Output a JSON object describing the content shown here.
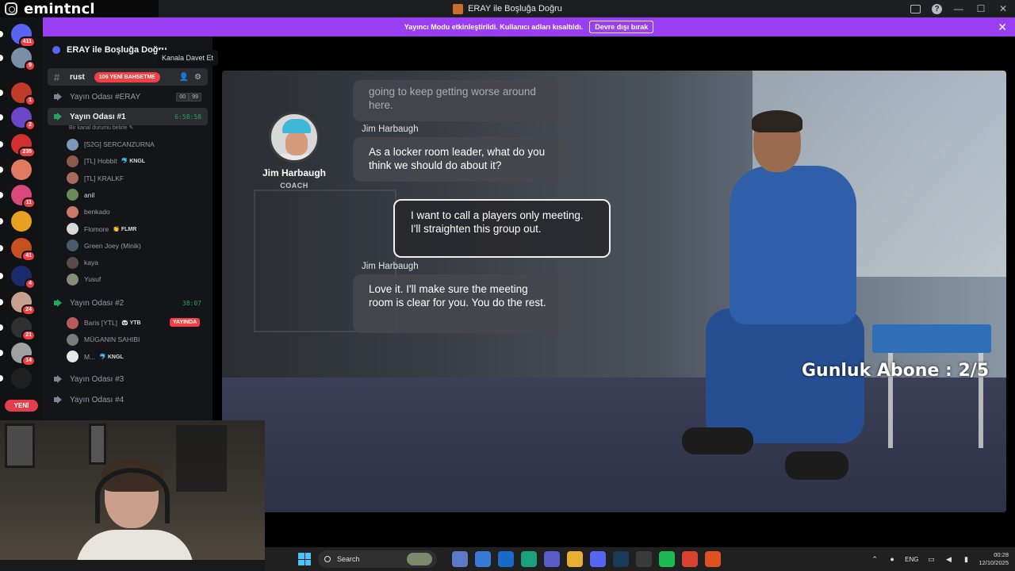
{
  "overlay": {
    "streamer_handle": "emintncl",
    "sub_counter": "Gunluk Abone : 2/5"
  },
  "window": {
    "title": "ERAY ile Boşluğa Doğru"
  },
  "banner": {
    "text": "Yayıncı Modu etkinleştirildi. Kullanıcı adları kısaltıldı.",
    "button": "Devre dışı bırak",
    "color": "#9a3ef2"
  },
  "rail": {
    "servers": [
      {
        "badge": "411",
        "color": "#5865f2"
      },
      {
        "badge": "9",
        "color": "#7a8ea8"
      },
      {
        "badge": "1",
        "color": "#c23b2a"
      },
      {
        "badge": "2",
        "color": "#6b46c8"
      },
      {
        "badge": "235",
        "color": "#d23030"
      },
      {
        "badge": "",
        "color": "#e07a60"
      },
      {
        "badge": "11",
        "color": "#d84878"
      },
      {
        "badge": "",
        "color": "#e8a020"
      },
      {
        "badge": "41",
        "color": "#c85020"
      },
      {
        "badge": "4",
        "color": "#1a2a6a"
      },
      {
        "badge": "24",
        "color": "#c8a090"
      },
      {
        "badge": "21",
        "color": "#303030"
      },
      {
        "badge": "14",
        "color": "#a0a0a0"
      },
      {
        "badge": "",
        "color": "#202020"
      }
    ],
    "new_label": "YENİ"
  },
  "sidebar": {
    "server_name": "ERAY ile Boşluğa Doğru",
    "tooltip": "Kanala Davet Et",
    "text_channel": {
      "name": "rust",
      "mentions": "106 YENİ BAHSETME"
    },
    "voice_channels": [
      {
        "name": "Yayın Odası #ERAY",
        "counter_a": "00",
        "counter_b": "99"
      },
      {
        "name": "Yayın Odası #1",
        "timer": "6:58:58",
        "status": "Bir kanal durumu belirle ✎"
      },
      {
        "name": "Yayın Odası #2",
        "timer": "38:07"
      },
      {
        "name": "Yayın Odası #3"
      },
      {
        "name": "Yayın Odası #4"
      }
    ],
    "room1_users": [
      {
        "name": "[S2G] SERCANZURNA",
        "tag": "",
        "color": "#7a98b8"
      },
      {
        "name": "[TL] Hobbit",
        "tag": "🐬 KNGL",
        "color": "#8a5a4a"
      },
      {
        "name": "[TL] KRALKF",
        "tag": "",
        "color": "#a86a5a"
      },
      {
        "name": "anil",
        "tag": "",
        "color": "#6a8a5a"
      },
      {
        "name": "benkado",
        "tag": "",
        "color": "#c87a6a"
      },
      {
        "name": "Flomore",
        "tag": "👏 FLMR",
        "color": "#d8d8d8"
      },
      {
        "name": "Green Joey (Minik)",
        "tag": "",
        "color": "#4a5a6a"
      },
      {
        "name": "kaya",
        "tag": "",
        "color": "#5a4a4a"
      },
      {
        "name": "Yusuf",
        "tag": "",
        "color": "#8a8a7a"
      }
    ],
    "room2_users": [
      {
        "name": "Baris [YTL]",
        "tag": "🐼 YTB",
        "color": "#b85a5a"
      },
      {
        "name": "MÜGANIN SAHIBI",
        "tag": "",
        "color": "#7a7a7a"
      },
      {
        "name": "M...",
        "tag": "🐬 KNGL",
        "color": "#e8e8e8"
      }
    ],
    "live_label": "YAYINDA"
  },
  "game": {
    "coach_name": "Jim Harbaugh",
    "coach_role": "COACH",
    "dialogue": [
      {
        "speaker": "",
        "text": "going to keep getting worse around here."
      },
      {
        "speaker": "Jim Harbaugh",
        "text": "As a locker room leader, what do you think we should do about it?"
      },
      {
        "speaker": "",
        "text": "I want to call a players only meeting. I'll straighten this group out."
      },
      {
        "speaker": "Jim Harbaugh",
        "text": "Love it. I'll make sure the meeting room is clear for you. You do the rest."
      }
    ]
  },
  "taskbar": {
    "search_placeholder": "Search",
    "language": "ENG",
    "time": "00:28",
    "date": "12/10/2025",
    "apps": [
      {
        "name": "copilot-icon",
        "color": "#5a7ac8"
      },
      {
        "name": "store-icon",
        "color": "#3a7ad8"
      },
      {
        "name": "outlook-icon",
        "color": "#1a6ac8"
      },
      {
        "name": "edge-icon",
        "color": "#1aa07a"
      },
      {
        "name": "teams-icon",
        "color": "#5a5ac8"
      },
      {
        "name": "explorer-icon",
        "color": "#e8b030"
      },
      {
        "name": "discord-icon",
        "color": "#5865f2"
      },
      {
        "name": "steam-icon",
        "color": "#1a3a5a"
      },
      {
        "name": "game-launcher-icon",
        "color": "#3a3a3a"
      },
      {
        "name": "spotify-icon",
        "color": "#1db954"
      },
      {
        "name": "chrome-icon",
        "color": "#d84030"
      },
      {
        "name": "ea-icon",
        "color": "#e05020"
      }
    ]
  }
}
